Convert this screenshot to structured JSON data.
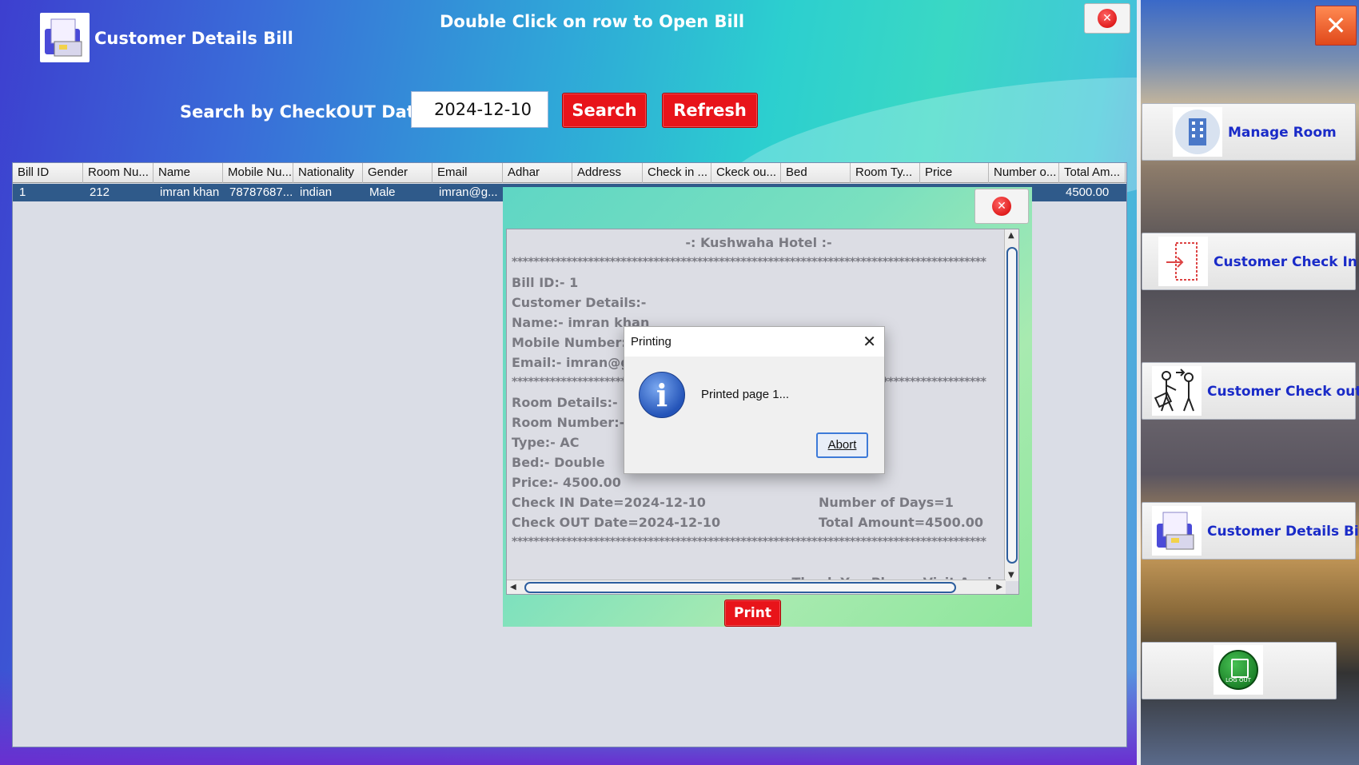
{
  "header": {
    "title": "Customer Details Bill",
    "hint": "Double Click on row to Open Bill"
  },
  "search": {
    "label": "Search by CheckOUT Date",
    "date_value": "2024-12-10",
    "search_label": "Search",
    "refresh_label": "Refresh"
  },
  "table": {
    "columns": [
      "Bill ID",
      "Room Nu...",
      "Name",
      "Mobile Nu...",
      "Nationality",
      "Gender",
      "Email",
      "Adhar",
      "Address",
      "Check in ...",
      "Ckeck ou...",
      "Bed",
      "Room Ty...",
      "Price",
      "Number o...",
      "Total Am..."
    ],
    "rows": [
      [
        "1",
        "212",
        "imran khan",
        "78787687...",
        "indian",
        "Male",
        "imran@g...",
        "",
        "",
        "",
        "",
        "",
        "",
        "",
        "",
        "4500.00"
      ]
    ]
  },
  "bill": {
    "lines": [
      "-: Kushwaha Hotel :-",
      "***************************************************************************************",
      "Bill ID:- 1",
      "Customer Details:-",
      "Name:- imran khan",
      "Mobile Number:",
      "Email:- imran@g",
      "***************************************************************************************",
      "Room Details:-",
      "Room Number:-",
      "Type:- AC",
      "Bed:- Double",
      "Price:- 4500.00",
      "Check IN Date=2024-12-10",
      "Check OUT Date=2024-12-10",
      "***************************************************************************************",
      "",
      "Thank You,Please Visit Again."
    ],
    "number_of_days": "Number of Days=1",
    "total_amount": "Total Amount=4500.00",
    "print_label": "Print"
  },
  "dialog": {
    "title": "Printing",
    "message": "Printed page 1...",
    "abort_label": "Abort"
  },
  "sidebar": {
    "items": [
      {
        "label": "Manage Room"
      },
      {
        "label": "Customer Check In"
      },
      {
        "label": "Customer Check out"
      },
      {
        "label": "Customer Details Bill"
      }
    ],
    "logout_text": "LOG OUT"
  },
  "colors": {
    "accent_red": "#e8141a",
    "sidebar_link": "#1a2bc8",
    "selected_row": "#2f5a8a"
  }
}
